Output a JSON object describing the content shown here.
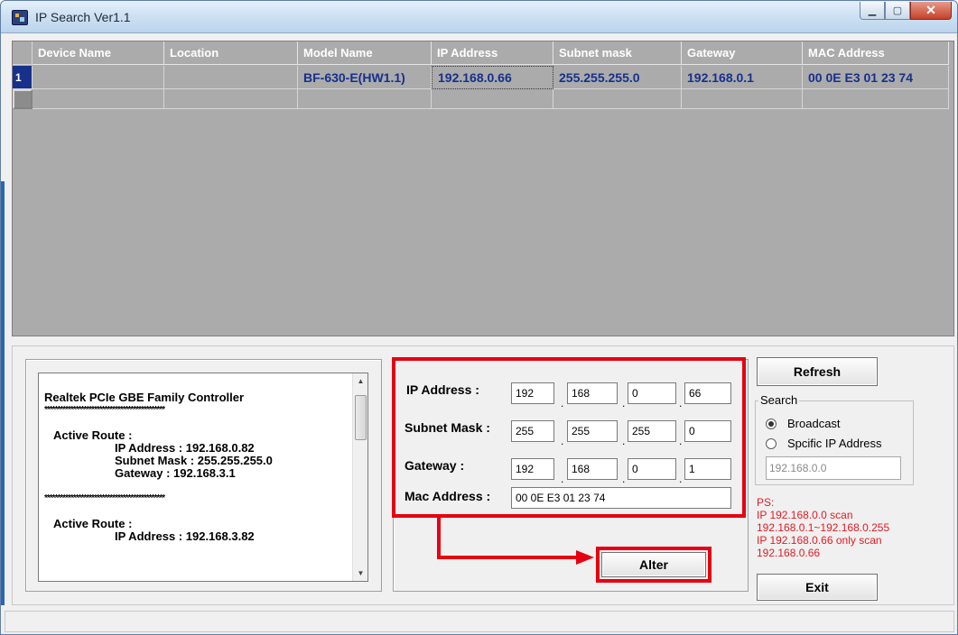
{
  "window": {
    "title": "IP Search Ver1.1"
  },
  "grid": {
    "headers": [
      "Device Name",
      "Location",
      "Model Name",
      "IP Address",
      "Subnet mask",
      "Gateway",
      "MAC Address"
    ],
    "rows": [
      {
        "index": "1",
        "device_name": "",
        "location": "",
        "model_name": "BF-630-E(HW1.1)",
        "ip_address": "192.168.0.66",
        "subnet_mask": "255.255.255.0",
        "gateway": "192.168.0.1",
        "mac_address": "00 0E E3 01 23 74"
      }
    ]
  },
  "info_panel": {
    "lines": [
      "Realtek PCIe GBE Family Controller",
      "**********************************************",
      "",
      "Active Route :",
      "IP Address : 192.168.0.82",
      "Subnet Mask : 255.255.255.0",
      "Gateway : 192.168.3.1",
      "",
      "**********************************************",
      "",
      "Active Route :",
      "IP Address : 192.168.3.82"
    ]
  },
  "fields": {
    "ip_address": {
      "label": "IP Address :",
      "octets": [
        "192",
        "168",
        "0",
        "66"
      ]
    },
    "subnet_mask": {
      "label": "Subnet Mask :",
      "octets": [
        "255",
        "255",
        "255",
        "0"
      ]
    },
    "gateway": {
      "label": "Gateway :",
      "octets": [
        "192",
        "168",
        "0",
        "1"
      ]
    },
    "mac_address": {
      "label": "Mac Address :",
      "value": "00 0E E3 01 23 74"
    }
  },
  "buttons": {
    "refresh": "Refresh",
    "alter": "Alter",
    "exit": "Exit"
  },
  "search": {
    "legend": "Search",
    "options": [
      {
        "label": "Broadcast",
        "selected": true
      },
      {
        "label": "Spcific IP Address",
        "selected": false
      }
    ],
    "ip_value": "192.168.0.0"
  },
  "ps_note": [
    "PS:",
    "IP 192.168.0.0 scan",
    "192.168.0.1~192.168.0.255",
    "IP 192.168.0.66 only scan",
    "192.168.0.66"
  ],
  "colors": {
    "highlight_red": "#e60012",
    "grid_bg": "#ababab",
    "data_text": "#17308c",
    "note_red": "#e31b23"
  }
}
